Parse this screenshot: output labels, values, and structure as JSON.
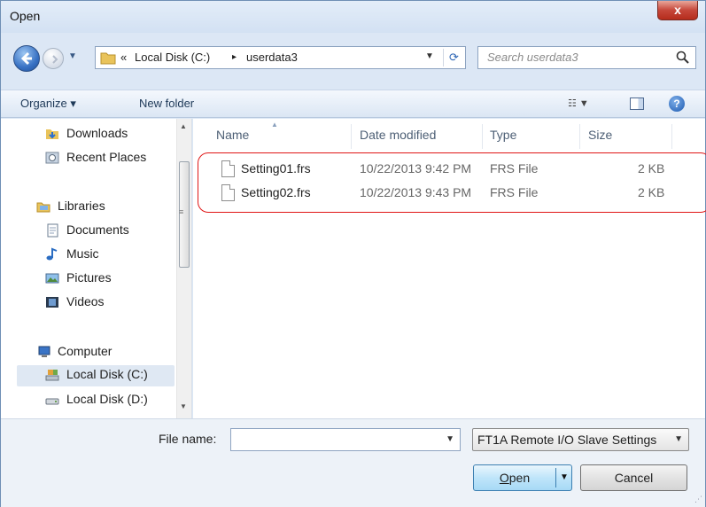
{
  "window": {
    "title": "Open",
    "close_glyph": "x"
  },
  "address": {
    "prefix": "«",
    "crumbs": [
      "Local Disk (C:)",
      "userdata3"
    ],
    "separator": "▸"
  },
  "search": {
    "placeholder": "Search userdata3"
  },
  "toolbar": {
    "organize": "Organize ▾",
    "new_folder": "New folder"
  },
  "nav": {
    "items": [
      {
        "label": "Downloads",
        "icon": "downloads-folder-icon"
      },
      {
        "label": "Recent Places",
        "icon": "recent-places-icon"
      },
      {
        "label": "Libraries",
        "icon": "libraries-icon"
      },
      {
        "label": "Documents",
        "icon": "documents-icon"
      },
      {
        "label": "Music",
        "icon": "music-icon"
      },
      {
        "label": "Pictures",
        "icon": "pictures-icon"
      },
      {
        "label": "Videos",
        "icon": "videos-icon"
      },
      {
        "label": "Computer",
        "icon": "computer-icon"
      },
      {
        "label": "Local Disk (C:)",
        "icon": "local-disk-icon",
        "selected": true
      },
      {
        "label": "Local Disk (D:)",
        "icon": "drive-icon"
      }
    ]
  },
  "files": {
    "columns": [
      "Name",
      "Date modified",
      "Type",
      "Size"
    ],
    "rows": [
      {
        "name": "Setting01.frs",
        "date": "10/22/2013 9:42 PM",
        "type": "FRS File",
        "size": "2 KB"
      },
      {
        "name": "Setting02.frs",
        "date": "10/22/2013 9:43 PM",
        "type": "FRS File",
        "size": "2 KB"
      }
    ]
  },
  "bottom": {
    "filename_label": "File name:",
    "filename_value": "",
    "filetype": "FT1A Remote I/O Slave Settings",
    "open_label_u": "O",
    "open_label_rest": "pen",
    "cancel_label": "Cancel"
  },
  "colors": {
    "accent": "#3c7fb1",
    "highlight": "#e01616",
    "titlebar": "#dce7f5"
  }
}
